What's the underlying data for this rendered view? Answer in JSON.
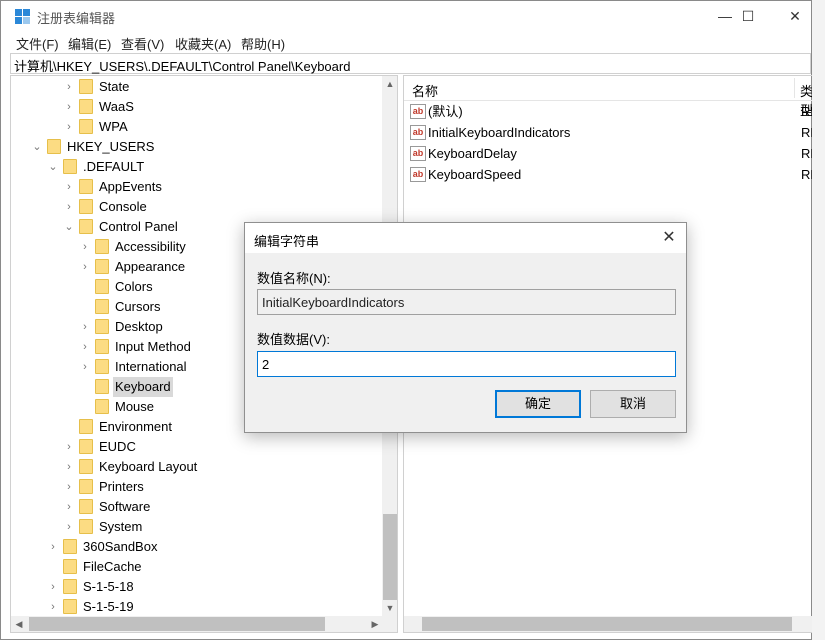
{
  "window": {
    "title": "注册表编辑器",
    "controls": {
      "minimize": "—",
      "maximize": "☐",
      "close": "✕"
    }
  },
  "menu": [
    "文件(F)",
    "编辑(E)",
    "查看(V)",
    "收藏夹(A)",
    "帮助(H)"
  ],
  "address": "计算机\\HKEY_USERS\\.DEFAULT\\Control Panel\\Keyboard",
  "tree": [
    {
      "label": "State",
      "depth": 2,
      "expander": "collapsed"
    },
    {
      "label": "WaaS",
      "depth": 2,
      "expander": "collapsed"
    },
    {
      "label": "WPA",
      "depth": 2,
      "expander": "collapsed"
    },
    {
      "label": "HKEY_USERS",
      "depth": 0,
      "expander": "expanded"
    },
    {
      "label": ".DEFAULT",
      "depth": 1,
      "expander": "expanded"
    },
    {
      "label": "AppEvents",
      "depth": 2,
      "expander": "collapsed"
    },
    {
      "label": "Console",
      "depth": 2,
      "expander": "collapsed"
    },
    {
      "label": "Control Panel",
      "depth": 2,
      "expander": "expanded"
    },
    {
      "label": "Accessibility",
      "depth": 3,
      "expander": "collapsed"
    },
    {
      "label": "Appearance",
      "depth": 3,
      "expander": "collapsed"
    },
    {
      "label": "Colors",
      "depth": 3,
      "expander": "none"
    },
    {
      "label": "Cursors",
      "depth": 3,
      "expander": "none"
    },
    {
      "label": "Desktop",
      "depth": 3,
      "expander": "collapsed"
    },
    {
      "label": "Input Method",
      "depth": 3,
      "expander": "collapsed"
    },
    {
      "label": "International",
      "depth": 3,
      "expander": "collapsed"
    },
    {
      "label": "Keyboard",
      "depth": 3,
      "expander": "none",
      "selected": true
    },
    {
      "label": "Mouse",
      "depth": 3,
      "expander": "none"
    },
    {
      "label": "Environment",
      "depth": 2,
      "expander": "none"
    },
    {
      "label": "EUDC",
      "depth": 2,
      "expander": "collapsed"
    },
    {
      "label": "Keyboard Layout",
      "depth": 2,
      "expander": "collapsed"
    },
    {
      "label": "Printers",
      "depth": 2,
      "expander": "collapsed"
    },
    {
      "label": "Software",
      "depth": 2,
      "expander": "collapsed"
    },
    {
      "label": "System",
      "depth": 2,
      "expander": "collapsed"
    },
    {
      "label": "360SandBox",
      "depth": 1,
      "expander": "collapsed"
    },
    {
      "label": "FileCache",
      "depth": 1,
      "expander": "none"
    },
    {
      "label": "S-1-5-18",
      "depth": 1,
      "expander": "collapsed"
    },
    {
      "label": "S-1-5-19",
      "depth": 1,
      "expander": "collapsed"
    }
  ],
  "list": {
    "headers": {
      "name": "名称",
      "type": "类型"
    },
    "rows": [
      {
        "name": "(默认)",
        "type": "RE"
      },
      {
        "name": "InitialKeyboardIndicators",
        "type": "RE"
      },
      {
        "name": "KeyboardDelay",
        "type": "RE"
      },
      {
        "name": "KeyboardSpeed",
        "type": "RE"
      }
    ],
    "icon_text": "ab"
  },
  "dialog": {
    "title": "编辑字符串",
    "close": "✕",
    "name_label": "数值名称(N):",
    "name_value": "InitialKeyboardIndicators",
    "data_label": "数值数据(V):",
    "data_value": "2",
    "ok": "确定",
    "cancel": "取消"
  }
}
